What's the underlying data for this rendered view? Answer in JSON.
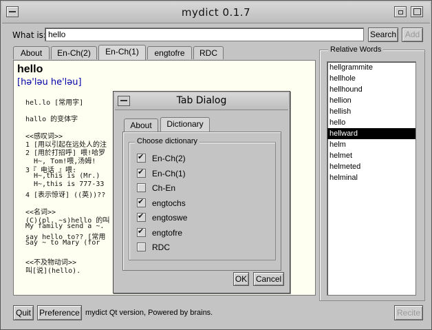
{
  "window": {
    "title": "mydict 0.1.7"
  },
  "search": {
    "label": "What is:",
    "value": "hello",
    "search_button": "Search",
    "add_button": "Add"
  },
  "tabs": [
    "About",
    "En-Ch(2)",
    "En-Ch(1)",
    "engtofre",
    "RDC"
  ],
  "content": {
    "word": "hello",
    "phonetic": "[hə'ləu he'ləu]",
    "lines": [
      "hel.lo [常用字]",
      "",
      "hallo 的变体字",
      "",
      "<<感叹词>>",
      "1 [用以引起在远处人的注",
      "2 [用於打招呼] 喂!哈罗",
      "  H~, Tom!喂,汤姆!",
      "3『 电话 』喂:",
      "  H~,this is (Mr.)",
      "  H~,this is 777-33",
      "4 [表示惊讶] ((英))??",
      "",
      "<<名词>>",
      "(C)(pl. ~s)hello 的叫",
      "My family send a ~.",
      "say hello to?? [常用",
      "Say ~ to Mary (for",
      "",
      "<<不及物动词>>",
      "叫[说](hello)."
    ]
  },
  "relative_words": {
    "title": "Relative Words",
    "items": [
      "hellgrammite",
      "hellhole",
      "hellhound",
      "hellion",
      "hellish",
      "hello",
      "hellward",
      "helm",
      "helmet",
      "helmeted",
      "helminal"
    ],
    "selected_index": 6
  },
  "bottom": {
    "quit": "Quit",
    "preference": "Preference",
    "status": "mydict Qt version, Powered by brains.",
    "recite": "Recite"
  },
  "dialog": {
    "title": "Tab Dialog",
    "tabs": [
      "About",
      "Dictionary"
    ],
    "group_title": "Choose dictionary",
    "dictionaries": [
      {
        "label": "En-Ch(2)",
        "checked": true
      },
      {
        "label": "En-Ch(1)",
        "checked": true
      },
      {
        "label": "Ch-En",
        "checked": false
      },
      {
        "label": "engtochs",
        "checked": true
      },
      {
        "label": "engtoswe",
        "checked": true
      },
      {
        "label": "engtofre",
        "checked": true
      },
      {
        "label": "RDC",
        "checked": false
      }
    ],
    "ok": "OK",
    "cancel": "Cancel"
  }
}
